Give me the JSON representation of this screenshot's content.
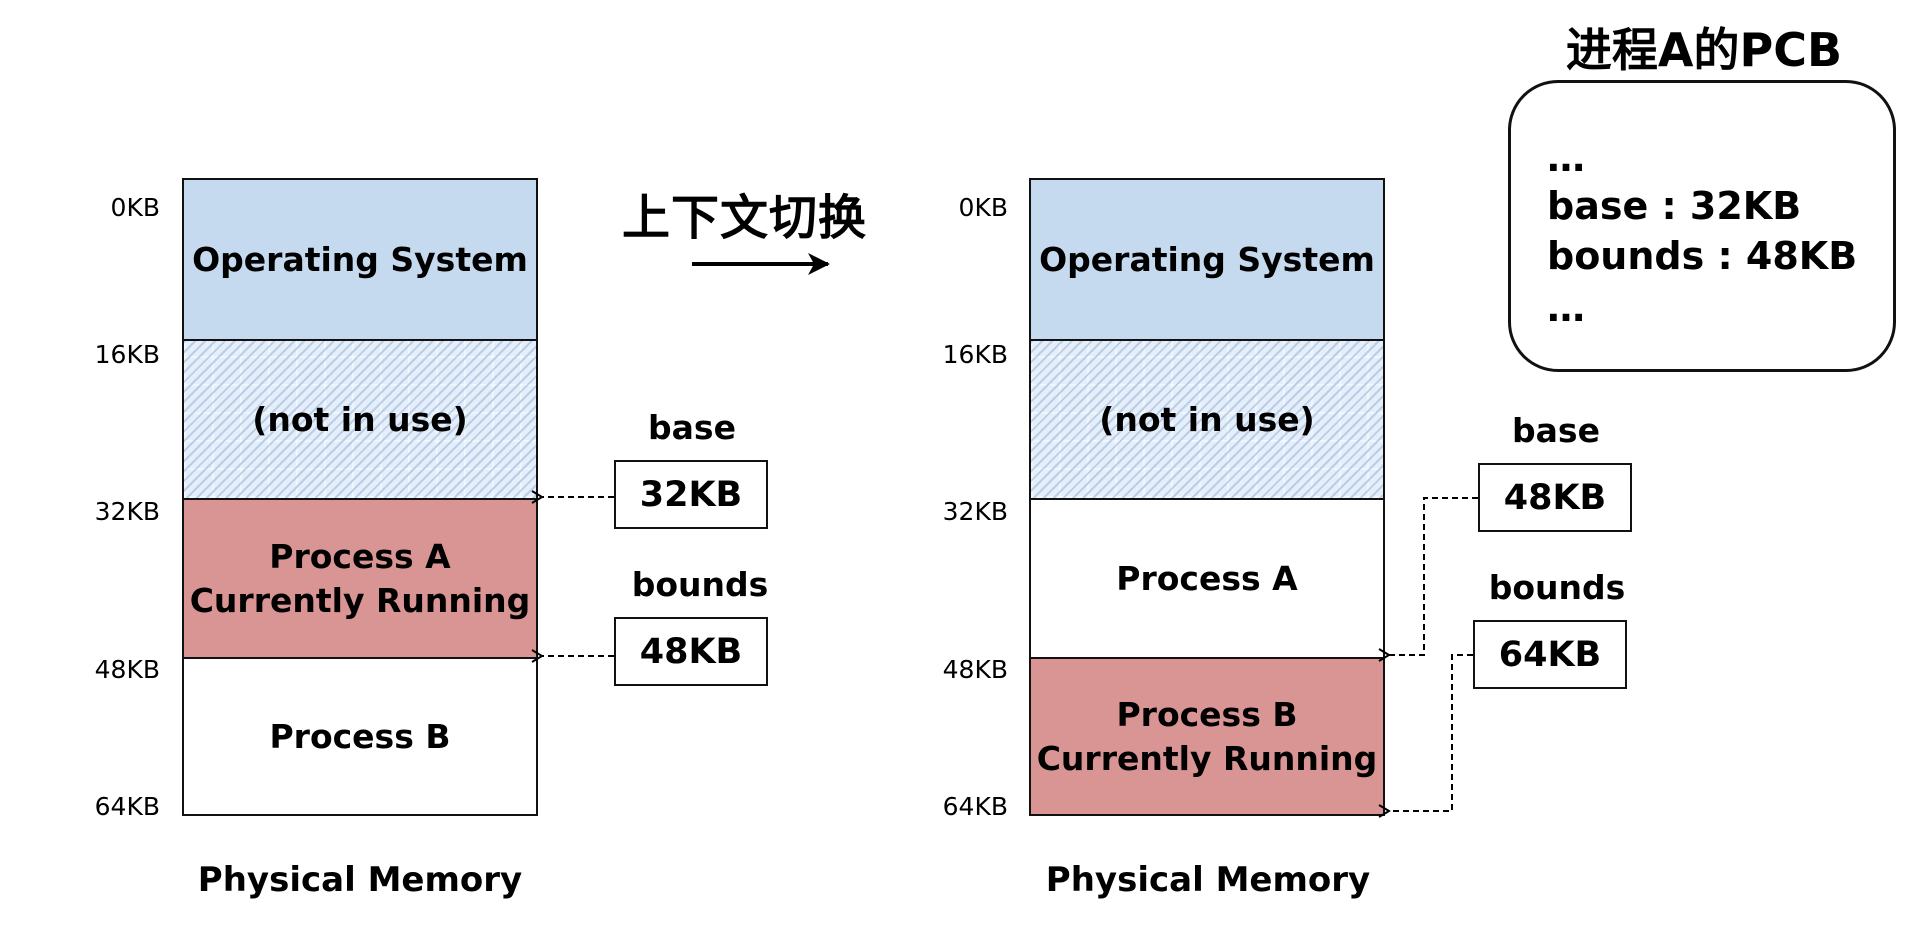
{
  "transition_label": "上下文切换",
  "address_labels": [
    "0KB",
    "16KB",
    "32KB",
    "48KB",
    "64KB"
  ],
  "before": {
    "caption": "Physical Memory",
    "segments": [
      {
        "label": "Operating System",
        "state": "os"
      },
      {
        "label": "(not in use)",
        "state": "free"
      },
      {
        "label": "Process A\nCurrently Running",
        "state": "running"
      },
      {
        "label": "Process B",
        "state": "idle"
      }
    ],
    "registers": {
      "base": {
        "label": "base",
        "value": "32KB"
      },
      "bounds": {
        "label": "bounds",
        "value": "48KB"
      }
    }
  },
  "after": {
    "caption": "Physical Memory",
    "segments": [
      {
        "label": "Operating System",
        "state": "os"
      },
      {
        "label": "(not in use)",
        "state": "free"
      },
      {
        "label": "Process A",
        "state": "idle"
      },
      {
        "label": "Process B\nCurrently Running",
        "state": "running"
      }
    ],
    "registers": {
      "base": {
        "label": "base",
        "value": "48KB"
      },
      "bounds": {
        "label": "bounds",
        "value": "64KB"
      }
    }
  },
  "pcb": {
    "title": "进程A的PCB",
    "lines": [
      "…",
      "base : 32KB",
      "bounds : 48KB",
      "…"
    ]
  },
  "colors": {
    "os": "#c5d9ef",
    "free": "#e6eef9",
    "running": "#d99494",
    "idle": "#ffffff"
  }
}
